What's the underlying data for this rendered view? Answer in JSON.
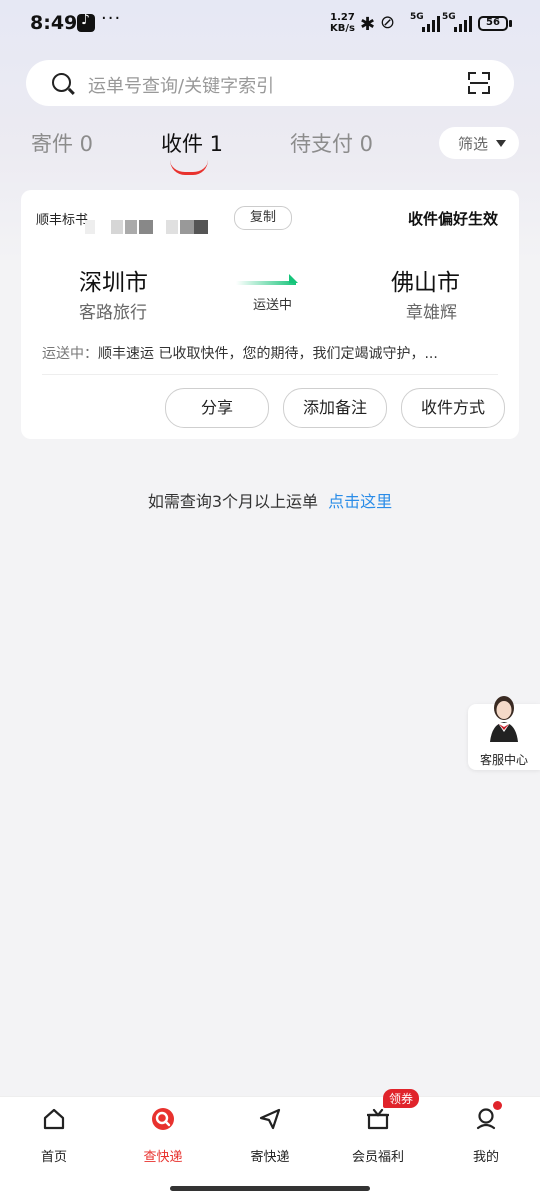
{
  "status_bar": {
    "time": "8:49",
    "network_speed_value": "1.27",
    "network_speed_unit": "KB/s",
    "signal_1": "5G",
    "signal_2": "5G",
    "battery": "56"
  },
  "search": {
    "placeholder": "运单号查询/关键字索引"
  },
  "tabs": [
    {
      "label": "寄件 0",
      "active": false
    },
    {
      "label": "收件 1",
      "active": true
    },
    {
      "label": "待支付 0",
      "active": false
    }
  ],
  "filter": {
    "label": "筛选"
  },
  "shipment": {
    "brand_label": "顺丰标书",
    "copy_label": "复制",
    "preference": "收件偏好生效",
    "from_city": "深圳市",
    "from_name": "客路旅行",
    "to_city": "佛山市",
    "to_name": "章雄辉",
    "status": "运送中",
    "track_label": "运送中：",
    "track_text": "顺丰速运 已收取快件，您的期待，我们定竭诚守护，...",
    "actions": [
      "分享",
      "添加备注",
      "收件方式"
    ]
  },
  "hint": {
    "text": "如需查询3个月以上运单",
    "link": "点击这里"
  },
  "customer_service": {
    "label": "客服中心"
  },
  "bottom_nav": {
    "items": [
      {
        "label": "首页",
        "icon": "home-icon",
        "active": false
      },
      {
        "label": "查快递",
        "icon": "search-express-icon",
        "active": true
      },
      {
        "label": "寄快递",
        "icon": "send-icon",
        "active": false
      },
      {
        "label": "会员福利",
        "icon": "gift-icon",
        "active": false
      },
      {
        "label": "我的",
        "icon": "profile-icon",
        "active": false
      }
    ],
    "coupon_badge": "领券"
  },
  "colors": {
    "accent": "#e8322e",
    "link": "#2a8ce8",
    "transit": "#16c47a"
  }
}
